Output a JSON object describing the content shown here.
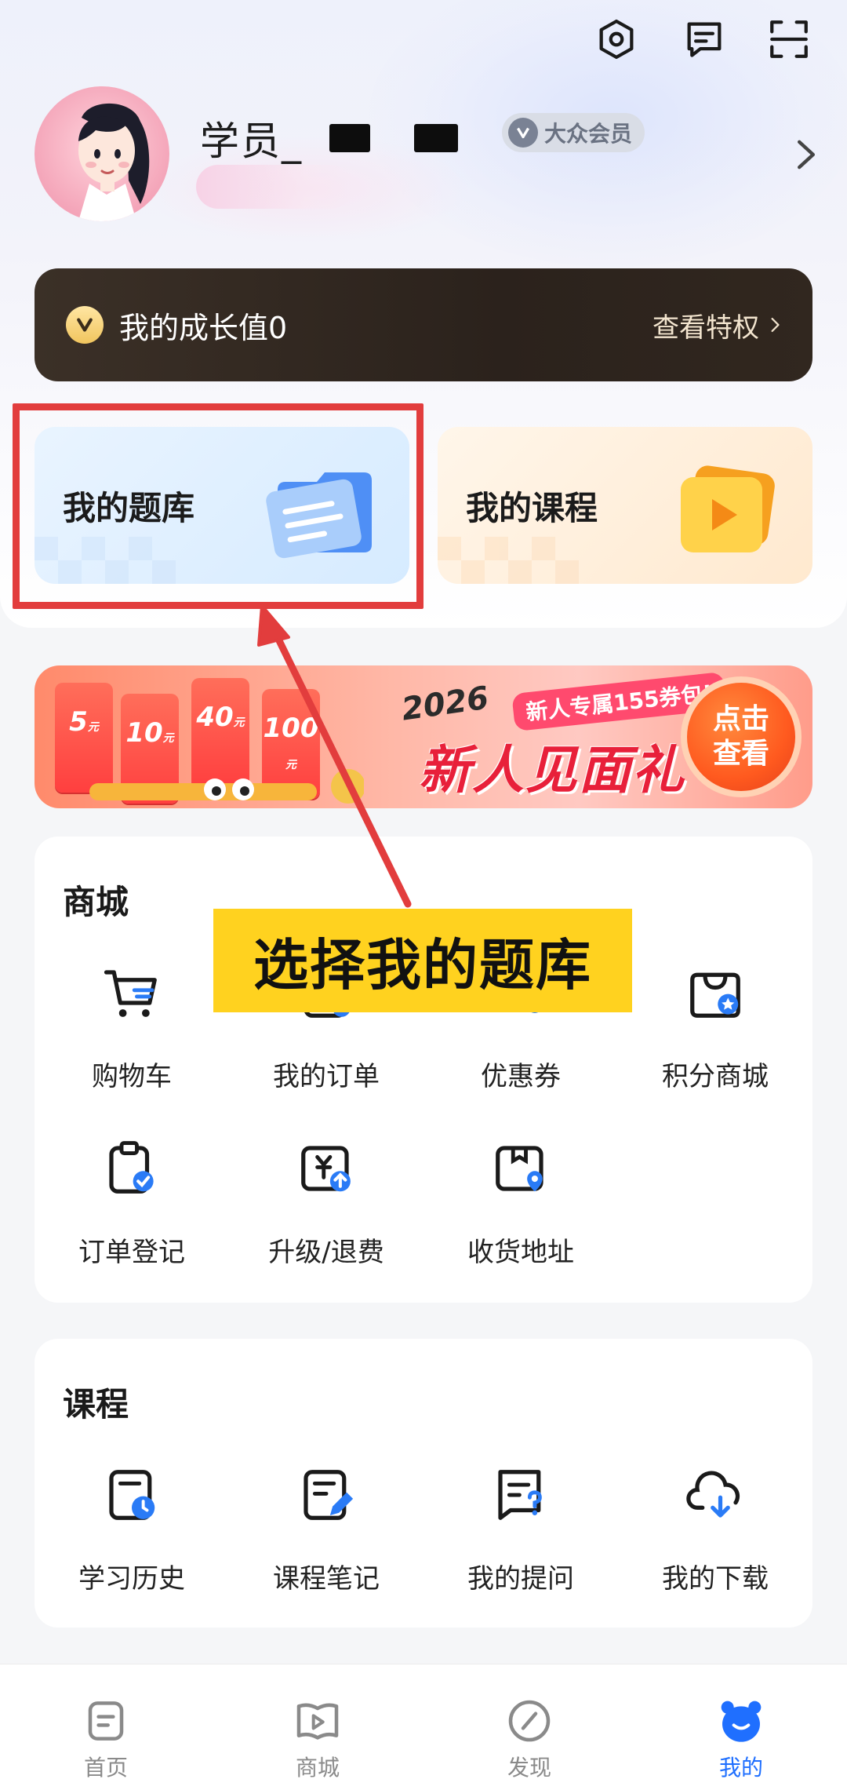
{
  "header": {
    "username": "学员_",
    "member_badge": "大众会员"
  },
  "growth": {
    "label": "我的成长值0",
    "privilege_link": "查看特权"
  },
  "features": {
    "question_bank": "我的题库",
    "my_courses": "我的课程"
  },
  "banner": {
    "year": "2026",
    "tag": "新人专属155券包!",
    "headline": "新人见面礼",
    "cta": "点击查看",
    "coupons": [
      {
        "value": "5",
        "unit": "元"
      },
      {
        "value": "10",
        "unit": "元"
      },
      {
        "value": "40",
        "unit": "元"
      },
      {
        "value": "100",
        "unit": "元"
      }
    ]
  },
  "mall": {
    "title": "商城",
    "items": [
      {
        "label": "购物车",
        "icon": "shopping-cart-icon"
      },
      {
        "label": "我的订单",
        "icon": "order-icon"
      },
      {
        "label": "优惠券",
        "icon": "coupon-icon"
      },
      {
        "label": "积分商城",
        "icon": "points-mall-icon"
      },
      {
        "label": "订单登记",
        "icon": "order-register-icon"
      },
      {
        "label": "升级/退费",
        "icon": "upgrade-refund-icon"
      },
      {
        "label": "收货地址",
        "icon": "address-icon"
      }
    ]
  },
  "course": {
    "title": "课程",
    "items": [
      {
        "label": "学习历史",
        "icon": "history-icon"
      },
      {
        "label": "课程笔记",
        "icon": "notes-icon"
      },
      {
        "label": "我的提问",
        "icon": "question-icon"
      },
      {
        "label": "我的下载",
        "icon": "download-icon"
      }
    ]
  },
  "annotation": {
    "label": "选择我的题库",
    "color": "#e23d3d"
  },
  "tabs": [
    {
      "label": "首页",
      "icon": "home-icon"
    },
    {
      "label": "商城",
      "icon": "mall-tab-icon"
    },
    {
      "label": "发现",
      "icon": "discover-icon"
    },
    {
      "label": "我的",
      "icon": "mine-icon",
      "active": true
    }
  ],
  "colors": {
    "accent": "#1f6fff",
    "highlight_yellow": "#ffd21f",
    "growth_bar": "#2b221c"
  }
}
